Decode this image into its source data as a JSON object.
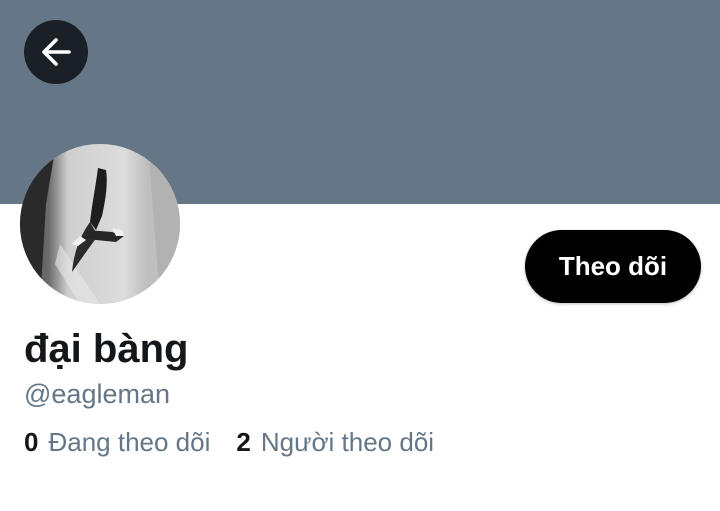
{
  "colors": {
    "banner": "#657786",
    "back_button_bg": "#1b2026",
    "follow_button_bg": "#000000",
    "secondary_text": "#657786",
    "primary_text": "#14171a"
  },
  "header": {
    "back_icon": "arrow-left-icon"
  },
  "profile": {
    "display_name": "đại bàng",
    "handle": "@eagleman",
    "avatar_icon": "eagle-tattoo-photo",
    "follow_label": "Theo dõi"
  },
  "stats": {
    "following_count": "0",
    "following_label": "Đang theo dõi",
    "followers_count": "2",
    "followers_label": "Người theo dõi"
  }
}
